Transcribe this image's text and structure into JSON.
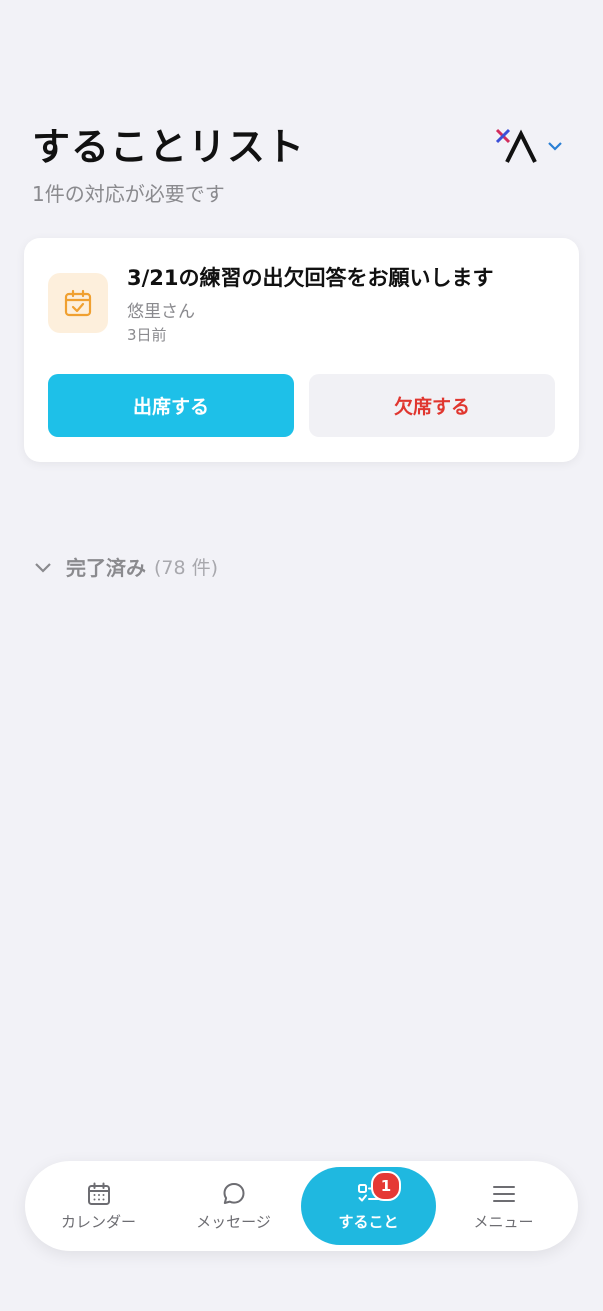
{
  "header": {
    "title": "することリスト",
    "subtitle": "1件の対応が必要です",
    "team_icon": "team-logo-icon"
  },
  "todo": {
    "title": "3/21の練習の出欠回答をお願いします",
    "sender": "悠里さん",
    "time": "3日前",
    "icon": "calendar-check-icon",
    "attend_label": "出席する",
    "absent_label": "欠席する"
  },
  "completed": {
    "label": "完了済み",
    "count": "(78 件)"
  },
  "tabs": [
    {
      "label": "カレンダー",
      "icon": "calendar-icon"
    },
    {
      "label": "メッセージ",
      "icon": "chat-bubble-icon"
    },
    {
      "label": "すること",
      "icon": "checklist-icon",
      "badge": "1"
    },
    {
      "label": "メニュー",
      "icon": "menu-icon"
    }
  ],
  "colors": {
    "accent": "#1ec0e8",
    "danger": "#e0362f",
    "background": "#f2f2f7"
  }
}
